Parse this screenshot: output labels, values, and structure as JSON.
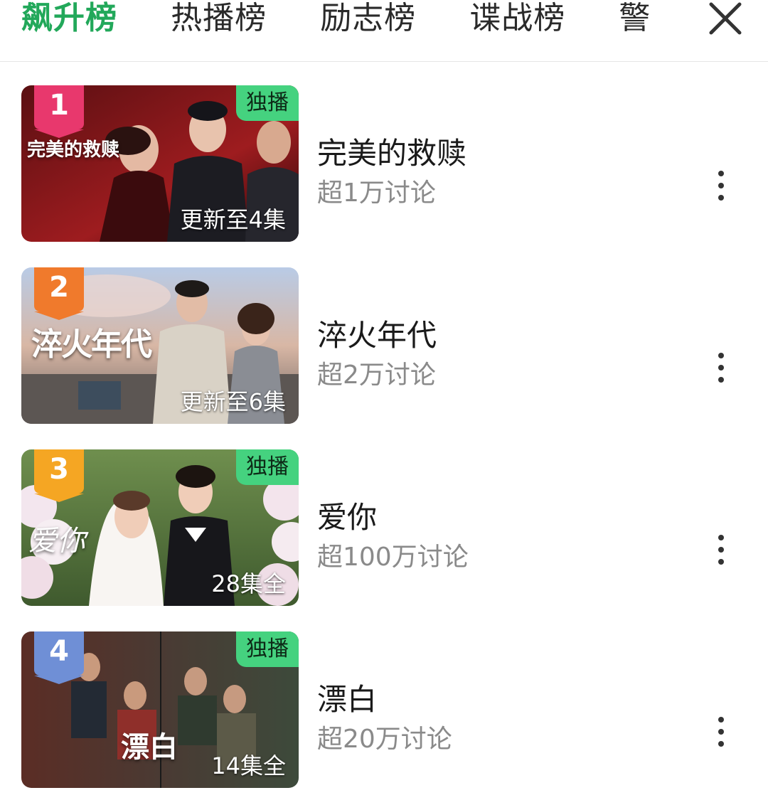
{
  "tabs": [
    {
      "label": "飙升榜",
      "active": true
    },
    {
      "label": "热播榜",
      "active": false
    },
    {
      "label": "励志榜",
      "active": false
    },
    {
      "label": "谍战榜",
      "active": false
    },
    {
      "label": "警",
      "active": false
    }
  ],
  "close_icon": "close-icon",
  "colors": {
    "accent": "#22a85a",
    "exclusive_badge": "#45d27f",
    "rank1": "#e8386d",
    "rank2": "#f07a2c",
    "rank3": "#f5a623",
    "rank4": "#6f8fd6"
  },
  "items": [
    {
      "rank": "1",
      "title": "完美的救赎",
      "discussion": "超1万讨论",
      "exclusive": "独播",
      "episodes": "更新至4集",
      "poster_title": "完美的救赎"
    },
    {
      "rank": "2",
      "title": "淬火年代",
      "discussion": "超2万讨论",
      "exclusive": "",
      "episodes": "更新至6集",
      "poster_title": "淬火年代"
    },
    {
      "rank": "3",
      "title": "爱你",
      "discussion": "超100万讨论",
      "exclusive": "独播",
      "episodes": "28集全",
      "poster_title": "爱你"
    },
    {
      "rank": "4",
      "title": "漂白",
      "discussion": "超20万讨论",
      "exclusive": "独播",
      "episodes": "14集全",
      "poster_title": "漂白"
    }
  ]
}
